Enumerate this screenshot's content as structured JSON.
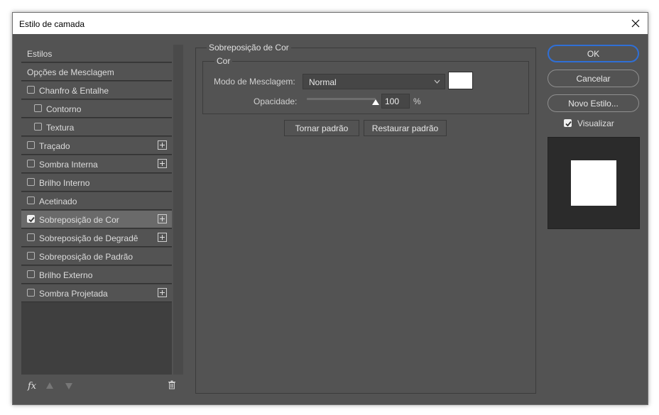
{
  "window": {
    "title": "Estilo de camada"
  },
  "styles_list": {
    "items": [
      {
        "label": "Estilos",
        "has_checkbox": false,
        "checked": false,
        "indent": false,
        "has_add": false,
        "selected": false
      },
      {
        "label": "Opções de Mesclagem",
        "has_checkbox": false,
        "checked": false,
        "indent": false,
        "has_add": false,
        "selected": false
      },
      {
        "label": "Chanfro & Entalhe",
        "has_checkbox": true,
        "checked": false,
        "indent": false,
        "has_add": false,
        "selected": false
      },
      {
        "label": "Contorno",
        "has_checkbox": true,
        "checked": false,
        "indent": true,
        "has_add": false,
        "selected": false
      },
      {
        "label": "Textura",
        "has_checkbox": true,
        "checked": false,
        "indent": true,
        "has_add": false,
        "selected": false
      },
      {
        "label": "Traçado",
        "has_checkbox": true,
        "checked": false,
        "indent": false,
        "has_add": true,
        "selected": false
      },
      {
        "label": "Sombra Interna",
        "has_checkbox": true,
        "checked": false,
        "indent": false,
        "has_add": true,
        "selected": false
      },
      {
        "label": "Brilho Interno",
        "has_checkbox": true,
        "checked": false,
        "indent": false,
        "has_add": false,
        "selected": false
      },
      {
        "label": "Acetinado",
        "has_checkbox": true,
        "checked": false,
        "indent": false,
        "has_add": false,
        "selected": false
      },
      {
        "label": "Sobreposição de Cor",
        "has_checkbox": true,
        "checked": true,
        "indent": false,
        "has_add": true,
        "selected": true
      },
      {
        "label": "Sobreposição de Degradê",
        "has_checkbox": true,
        "checked": false,
        "indent": false,
        "has_add": true,
        "selected": false
      },
      {
        "label": "Sobreposição de Padrão",
        "has_checkbox": true,
        "checked": false,
        "indent": false,
        "has_add": false,
        "selected": false
      },
      {
        "label": "Brilho Externo",
        "has_checkbox": true,
        "checked": false,
        "indent": false,
        "has_add": false,
        "selected": false
      },
      {
        "label": "Sombra Projetada",
        "has_checkbox": true,
        "checked": false,
        "indent": false,
        "has_add": true,
        "selected": false
      }
    ],
    "footer": {
      "fx_label": "fx"
    }
  },
  "panel": {
    "section_title": "Sobreposição de Cor",
    "group_title": "Cor",
    "blend_mode_label": "Modo de Mesclagem:",
    "blend_mode_value": "Normal",
    "color_swatch": "#ffffff",
    "opacity_label": "Opacidade:",
    "opacity_value": "100",
    "opacity_percent": 100,
    "opacity_unit": "%",
    "make_default_label": "Tornar padrão",
    "reset_default_label": "Restaurar padrão"
  },
  "actions": {
    "ok_label": "OK",
    "cancel_label": "Cancelar",
    "new_style_label": "Novo Estilo...",
    "preview_label": "Visualizar",
    "preview_checked": true
  },
  "colors": {
    "dialog_bg": "#535353",
    "list_selected": "#6a6a6a",
    "accent": "#2f6fd6"
  }
}
